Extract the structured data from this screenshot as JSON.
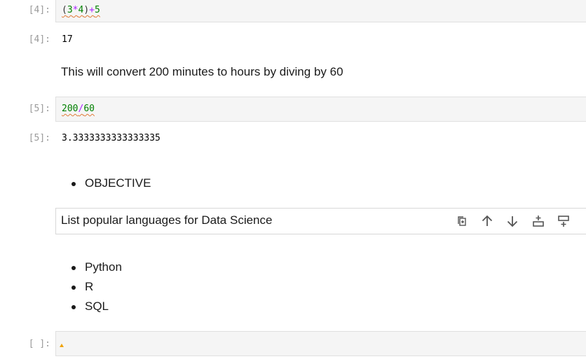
{
  "cells": {
    "c4": {
      "prompt": "[4]:",
      "code_tokens": [
        "(",
        "3",
        "*",
        "4",
        ")",
        "+",
        "5"
      ],
      "out_prompt": "[4]:",
      "output": "17"
    },
    "md1": {
      "text": "This will convert 200 minutes to hours by diving by 60"
    },
    "c5": {
      "prompt": "[5]:",
      "code_tokens": [
        "200",
        "/",
        "60"
      ],
      "out_prompt": "[5]:",
      "output": "3.3333333333333335"
    },
    "md2": {
      "items": [
        "OBJECTIVE"
      ]
    },
    "md_edit": {
      "text": "List popular languages for Data Science"
    },
    "md3": {
      "items": [
        "Python",
        "R",
        "SQL"
      ]
    },
    "c_empty": {
      "prompt": "[ ]:"
    }
  },
  "toolbar": {
    "icons": [
      "duplicate-icon",
      "move-up-icon",
      "move-down-icon",
      "insert-above-icon",
      "insert-below-icon"
    ]
  },
  "colors": {
    "prompt": "#9a9a9a",
    "code_bg": "#f5f5f5",
    "number": "#008000",
    "operator": "#aa22ff",
    "squiggle": "#e07b39",
    "warning": "#f0a30a"
  }
}
